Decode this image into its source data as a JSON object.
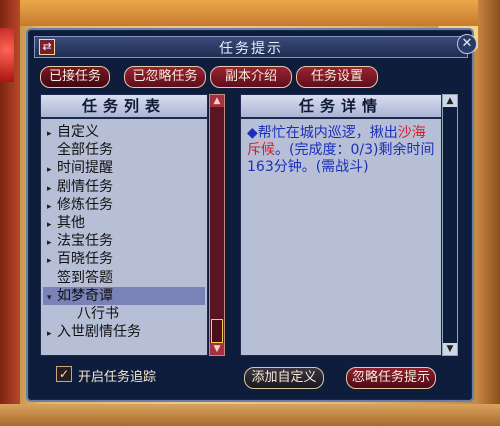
{
  "window": {
    "title": "任务提示",
    "tabs": [
      "已接任务",
      "已忽略任务",
      "副本介绍",
      "任务设置"
    ]
  },
  "task_list": {
    "title": "任务列表",
    "items": [
      {
        "label": "自定义",
        "arrow": "▸"
      },
      {
        "label": "全部任务",
        "arrow": ""
      },
      {
        "label": "时间提醒",
        "arrow": "▸"
      },
      {
        "label": "剧情任务",
        "arrow": "▸"
      },
      {
        "label": "修炼任务",
        "arrow": "▸"
      },
      {
        "label": "其他",
        "arrow": "▸"
      },
      {
        "label": "法宝任务",
        "arrow": "▸"
      },
      {
        "label": "百晓任务",
        "arrow": "▸"
      },
      {
        "label": "签到答题",
        "arrow": ""
      },
      {
        "label": "如梦奇谭",
        "arrow": "▾"
      },
      {
        "label": "八行书",
        "arrow": ""
      },
      {
        "label": "入世剧情任务",
        "arrow": "▸"
      }
    ],
    "selected_index": 9
  },
  "task_detail": {
    "title": "任务详情",
    "bullet": "◆",
    "text_part1": "帮忙在城内巡逻，揪出",
    "text_highlight": "沙海斥候",
    "text_part2": "。(完成度：0/3)剩余时间163分钟。(需战斗)"
  },
  "footer": {
    "checkbox_label": "开启任务追踪",
    "checkbox_mark": "✓",
    "add_custom": "添加自定义",
    "ignore_task": "忽略任务提示"
  },
  "icons": {
    "swap": "⇄",
    "close": "✕",
    "scroll_up": "▲",
    "scroll_down": "▼"
  }
}
